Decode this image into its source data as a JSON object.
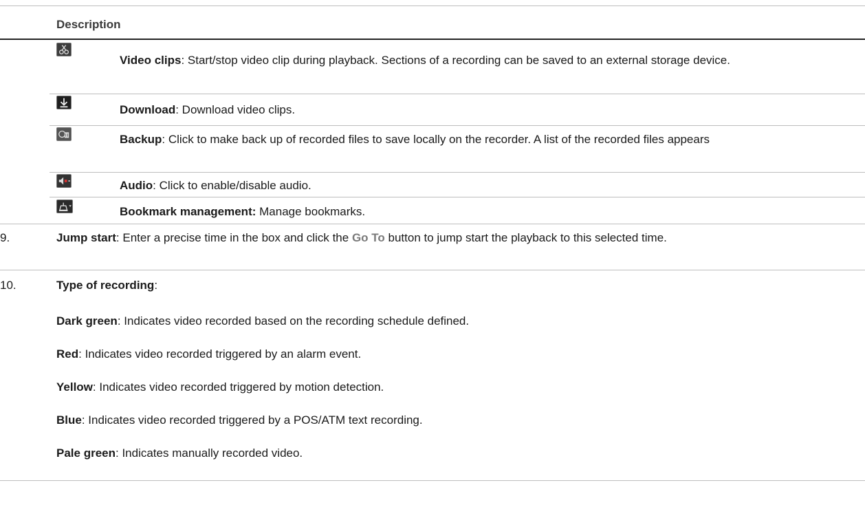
{
  "header": {
    "title": "Description"
  },
  "icon_rows": [
    {
      "icon": "scissors-icon",
      "term": "Video clips",
      "sep": ": ",
      "text": "Start/stop video clip during playback. Sections of a recording can be saved to an external storage device."
    },
    {
      "icon": "download-icon",
      "term": "Download",
      "sep": ": ",
      "text": "Download video clips."
    },
    {
      "icon": "backup-icon",
      "term": "Backup",
      "sep": ": ",
      "text": "Click to make back up of recorded files to save locally on the recorder. A list of the recorded files appears"
    },
    {
      "icon": "audio-icon",
      "term": "Audio",
      "sep": ": ",
      "text": "Click to enable/disable audio."
    },
    {
      "icon": "bookmark-icon",
      "term": "Bookmark management:",
      "sep": " ",
      "text": "Manage bookmarks."
    }
  ],
  "item9": {
    "number": "9.",
    "term": "Jump start",
    "text_a": ": Enter a precise time in the box and click the ",
    "button_label": "Go To",
    "text_b": " button to jump start the playback to this selected time."
  },
  "item10": {
    "number": "10.",
    "term": "Type of recording",
    "colon": ":",
    "legend": [
      {
        "name": "Dark green",
        "text": ": Indicates video recorded based on the recording schedule defined."
      },
      {
        "name": "Red",
        "text": ": Indicates video recorded triggered by an alarm event."
      },
      {
        "name": "Yellow",
        "text": ": Indicates video recorded triggered by motion detection."
      },
      {
        "name": "Blue",
        "text": ": Indicates video recorded triggered by a POS/ATM text recording."
      },
      {
        "name": "Pale green",
        "text": ": Indicates manually recorded video."
      }
    ]
  }
}
